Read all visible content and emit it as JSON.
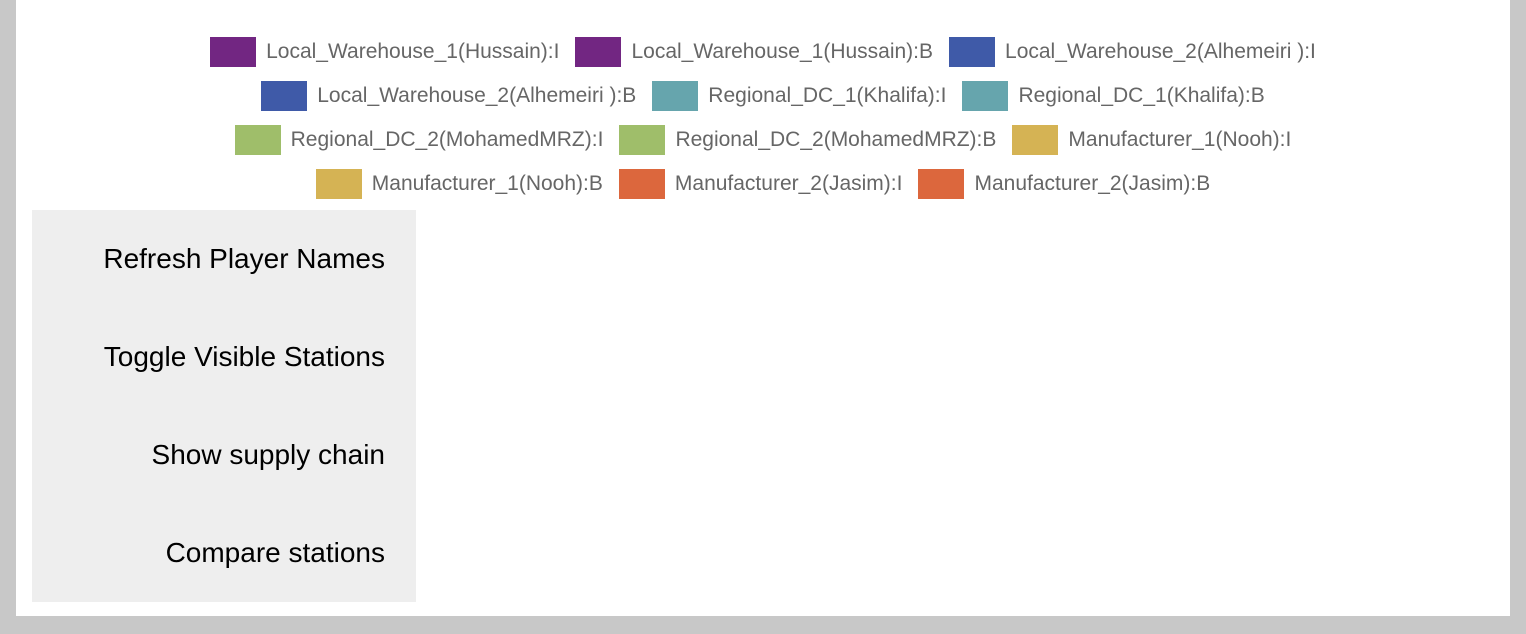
{
  "legend": {
    "rows": [
      [
        {
          "label": "Local_Warehouse_1(Hussain):I",
          "color": "#722682"
        },
        {
          "label": "Local_Warehouse_1(Hussain):B",
          "color": "#722682"
        },
        {
          "label": "Local_Warehouse_2(Alhemeiri ):I",
          "color": "#3f5aa8"
        }
      ],
      [
        {
          "label": "Local_Warehouse_2(Alhemeiri ):B",
          "color": "#3f5aa8"
        },
        {
          "label": "Regional_DC_1(Khalifa):I",
          "color": "#66a5ad"
        },
        {
          "label": "Regional_DC_1(Khalifa):B",
          "color": "#66a5ad"
        }
      ],
      [
        {
          "label": "Regional_DC_2(MohamedMRZ):I",
          "color": "#9fbe6a"
        },
        {
          "label": "Regional_DC_2(MohamedMRZ):B",
          "color": "#9fbe6a"
        },
        {
          "label": "Manufacturer_1(Nooh):I",
          "color": "#d5b354"
        }
      ],
      [
        {
          "label": "Manufacturer_1(Nooh):B",
          "color": "#d5b354"
        },
        {
          "label": "Manufacturer_2(Jasim):I",
          "color": "#dc673d"
        },
        {
          "label": "Manufacturer_2(Jasim):B",
          "color": "#dc673d"
        }
      ]
    ]
  },
  "menu": {
    "refresh": "Refresh Player Names",
    "toggle": "Toggle Visible Stations",
    "supply_chain": "Show supply chain",
    "compare": "Compare stations"
  }
}
